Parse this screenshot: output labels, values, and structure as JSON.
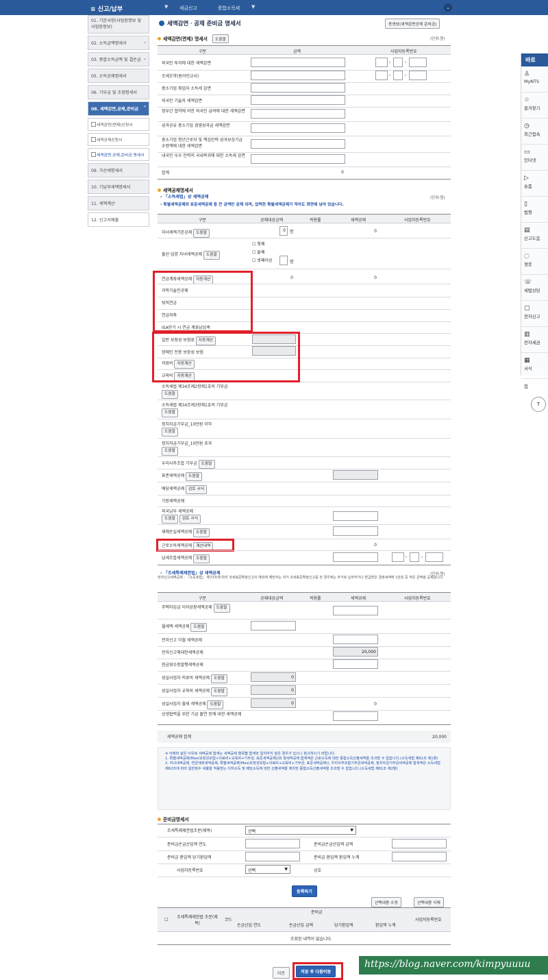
{
  "topbar": {
    "menu": "신고/납부",
    "crumb1": "세금신고",
    "crumb2": "종합소득세"
  },
  "sidebar": {
    "items": [
      {
        "label": "01. 기본사항(사업장명보 및 사업장정보)"
      },
      {
        "label": "02. 소득금액명세서"
      },
      {
        "label": "03. 종합소득금액 및 결손금"
      },
      {
        "label": "05. 소득공제명세서"
      },
      {
        "label": "06. 기부금 및 조정명세서"
      },
      {
        "label": "08. 세액감면,공제,준비금"
      },
      {
        "label": "세액감면(면제)신청서"
      },
      {
        "label": "세액공제신청서"
      },
      {
        "label": "세액감면,공제,준비금 명세서"
      },
      {
        "label": "09. 가산세명세서"
      },
      {
        "label": "10. 기납부세액명세서"
      },
      {
        "label": "11. 세액계산"
      },
      {
        "label": "12. 신고서제출"
      }
    ]
  },
  "page": {
    "title": "세액감면ㆍ공제 준비금 명세서",
    "video_btn": "동영상(세액감면공제 준비금)",
    "unit": "(단위:원)"
  },
  "s1": {
    "title": "세액감면(면제) 명세서",
    "help": "도움말",
    "h_item": "구분",
    "h_amt": "금액",
    "h_biz": "사업자등록번호",
    "rows": [
      "외국인 투자에 대한 세액감면",
      "조세조약(원어민교사)",
      "중소기업 취업자 소득세 감면",
      "외국인 기술자 세액감면",
      "정부간 협약에 의한 외국인 급여에 대한 세액감면",
      "성과공유 중소기업 경영성과급 세액감면",
      "중소기업 청년근로자 및 핵심인력 성과보상기금 수령액에 대한 세액감면",
      "내국인 우수 인력의 국내복귀에 대한 소득세 감면"
    ],
    "total_label": "합계",
    "total": "0"
  },
  "s2": {
    "title": "세액공제명세서",
    "link": "「소득세법」상 세액공제",
    "notice": "특별세액공제와 표준세액공제 중 큰 금액만 공제 되며, 입력한 특별세액공제가 작아도 화면에 남아 있습니다.",
    "h_item": "구분",
    "h_base": "공제대상금액",
    "h_rate": "적용률",
    "h_credit": "세액공제",
    "h_biz": "사업자등록번호",
    "child": "자녀세액기본공제",
    "child_count": "0",
    "child_unit": "명",
    "child_credit": "0",
    "birth": "출산·입양 자녀세액공제",
    "birth_opts": [
      "첫째",
      "둘째",
      "셋째이상"
    ],
    "birth_unit": "명",
    "pension": "연금계좌세액공제",
    "auto": "자동계산",
    "pension_base": "0",
    "pension_credit": "0",
    "pension_subs": [
      "과학기술인공제",
      "퇴직연금",
      "연금저축",
      "ISA만기 시 연금 계좌납입액"
    ],
    "ins1": "일반 보장성 보험료",
    "ins2": "장애인 전용 보장성 보험",
    "med": "의료비",
    "edu": "교육비",
    "don1": "소득세법 제34조제2항제1호의 기부금",
    "don2": "소득세법 제34조제3항제1호의 기부금",
    "pol1": "정치자금기부금_10만원 이하",
    "pol2": "정치자금기부금_10만원 초과",
    "esop": "우리사주조합 기부금",
    "std": "표준세액공제",
    "div": "배당세액공제",
    "review": "검토 서식",
    "book": "기장세액공제",
    "foreign": "외국납부 세액공제",
    "disaster": "재해손실세액공제",
    "earned": "근로소득세액공제",
    "calc": "계산내역",
    "earned_credit": "0",
    "union": "납세조합세액공제"
  },
  "s3": {
    "link": "「조세특례제한법」상 세액공제",
    "note": "전자신고세액공제 : 「소득세법」 제73조에 따라 과세표준확정신고의 예외에 해당하는 자가 과세표준확정신고를 한 경우에는 추가로 납부하거나 환급받은 결정세액에 1만원 중 적은 금액을 공제합니다.",
    "h_item": "구분",
    "h_base": "공제대상금액",
    "h_rate": "적용률",
    "h_credit": "세액공제",
    "h_biz": "사업자등록번호",
    "rows": [
      "주택차입금 이자상환세액공제",
      "월세액 세액공제",
      "전자신고 이월 세액공제",
      "전자신고에대한세액공제",
      "현금영수증발행세액공제",
      "성실사업자 의료비 세액공제",
      "성실사업자 교육비 세액공제",
      "성실사업자 월세 세액공제",
      "상생협력을 위한 기금 출연 등에 대한 세액공제"
    ],
    "ecredit": "20,000",
    "z1": "0",
    "z2": "0",
    "z3": "0",
    "z4": "0",
    "total_label": "세액공제 합계",
    "total": "20,000"
  },
  "notice": [
    "※ 아래와 같은 이유로 세액공제 합계는 세액공제 항목별 합계와 일치하지 않은 경우가 있으니 참고하시기 바랍니다.",
    "1. 특별세액공제(Max(보장성보험+의료비+교육비+기부금, 표준세액공제))와 월세액공제 합계액은 근로소득에 대한 종합소득산출세액을 초과할 수 없습니다.(소득세법 제61조 제1항)",
    "2. 자녀세액공제, 연금계좌세액공제, 특별세액공제(Max(보장성보험+의료비+교육비+기부금, 표준세액공제)), 우리사주조합기부금세액공제, 정치자금기부금세액공제 합계액은 소득세법 제62조에 따라 일반정수 세율을 적용받는 이자소득 및 배당소득에 대한 산출세액을 제외한 종합소득산출세액을 초과할 수 없습니다.(소득세법 제61조 제2항)"
  ],
  "s4": {
    "title": "준비금명세서",
    "l1": "조세특례제한법조문(제목)",
    "sel": "선택",
    "l2": "준비금손금산입액 연도",
    "l3": "준비금손금산입액 금액",
    "l4": "준비금 환입액 당기환입액",
    "l5": "준비금 환입액 환입액 누계",
    "l6": "사업자등록번호",
    "sel2": "선택",
    "l7": "상호",
    "register": "등록하기",
    "edit": "선택내용 수정",
    "del": "선택내용 삭제",
    "th": [
      "조세특례제한법 조문(제목)",
      "코드",
      "준비금",
      "사업자등록번호"
    ],
    "th_sub": [
      "손금산입 연도",
      "손금산입 금액",
      "당기환입액",
      "환입액 누계"
    ],
    "empty": "조회된 내역이 없습니다."
  },
  "footer": {
    "prev": "이전",
    "next": "저장 후 다음이동"
  },
  "rpanel": {
    "title": "바로",
    "items": [
      "MyNTS",
      "즐겨찾기",
      "최근접속",
      "인터넷",
      "숏폼",
      "법령",
      "신고도움",
      "챗봇",
      "세법상담",
      "전자신고",
      "전자세금",
      "서식",
      "접"
    ]
  },
  "watermark": "https://blog.naver.com/kimpyuuuu"
}
